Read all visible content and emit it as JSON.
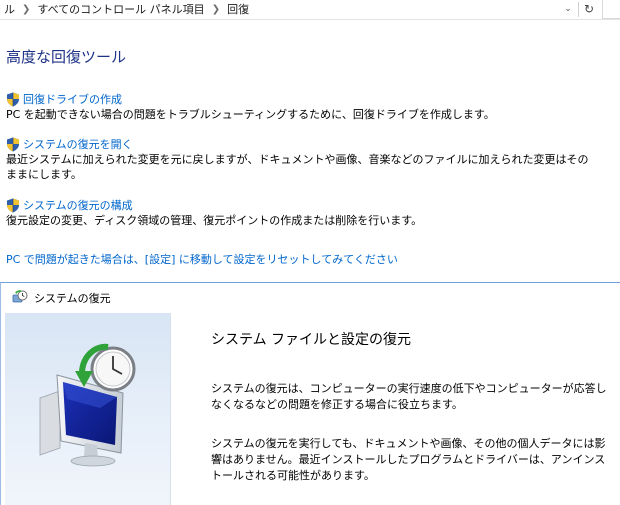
{
  "address_bar": {
    "crumbs": [
      "ル",
      "すべてのコントロール パネル項目",
      "回復"
    ],
    "dropdown_icon": "chevron-down-icon",
    "refresh_icon": "refresh-icon"
  },
  "main": {
    "title": "高度な回復ツール",
    "tools": [
      {
        "link": "回復ドライブの作成",
        "desc": "PC を起動できない場合の問題をトラブルシューティングするために、回復ドライブを作成します。",
        "icon": "uac-shield-icon"
      },
      {
        "link": "システムの復元を開く",
        "desc": "最近システムに加えられた変更を元に戻しますが、ドキュメントや画像、音楽などのファイルに加えられた変更はそのままにします。",
        "icon": "uac-shield-icon"
      },
      {
        "link": "システムの復元の構成",
        "desc": "復元設定の変更、ディスク領域の管理、復元ポイントの作成または削除を行います。",
        "icon": "uac-shield-icon"
      }
    ],
    "pc_reset_link": "PC で問題が起きた場合は、[設定] に移動して設定をリセットしてみてください"
  },
  "dialog": {
    "title": "システムの復元",
    "title_icon": "system-restore-icon",
    "heading": "システム ファイルと設定の復元",
    "para1": "システムの復元は、コンピューターの実行速度の低下やコンピューターが応答しなくなるなどの問題を修正する場合に役立ちます。",
    "para2": "システムの復元を実行しても、ドキュメントや画像、その他の個人データには影響はありません。最近インストールしたプログラムとドライバーは、アンインストールされる可能性があります。",
    "illustration": "computer-clock-restore-illustration"
  }
}
